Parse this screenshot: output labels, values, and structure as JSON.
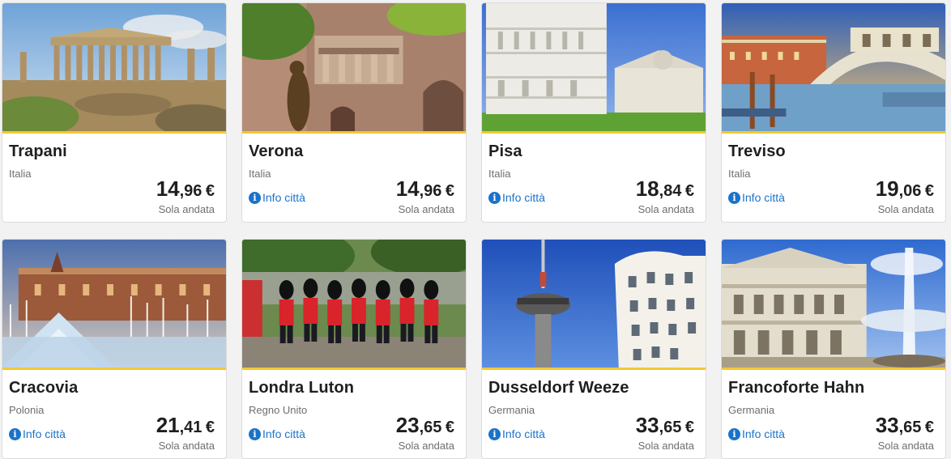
{
  "cards": [
    {
      "city": "Trapani",
      "country": "Italia",
      "info": "",
      "price_int": "14",
      "price_dec": "96",
      "currency": "€",
      "trip": "Sola andata",
      "image": "greek-temple-ruins-photo"
    },
    {
      "city": "Verona",
      "country": "Italia",
      "info": "Info città",
      "price_int": "14",
      "price_dec": "96",
      "currency": "€",
      "trip": "Sola andata",
      "image": "juliet-statue-balcony-photo"
    },
    {
      "city": "Pisa",
      "country": "Italia",
      "info": "Info città",
      "price_int": "18",
      "price_dec": "84",
      "currency": "€",
      "trip": "Sola andata",
      "image": "leaning-tower-cathedral-photo"
    },
    {
      "city": "Treviso",
      "country": "Italia",
      "info": "Info città",
      "price_int": "19",
      "price_dec": "06",
      "currency": "€",
      "trip": "Sola andata",
      "image": "canal-bridge-photo"
    },
    {
      "city": "Cracovia",
      "country": "Polonia",
      "info": "Info città",
      "price_int": "21",
      "price_dec": "41",
      "currency": "€",
      "trip": "Sola andata",
      "image": "cloth-hall-fountain-photo"
    },
    {
      "city": "Londra Luton",
      "country": "Regno Unito",
      "info": "Info città",
      "price_int": "23",
      "price_dec": "65",
      "currency": "€",
      "trip": "Sola andata",
      "image": "royal-guards-parade-photo"
    },
    {
      "city": "Dusseldorf Weeze",
      "country": "Germania",
      "info": "Info città",
      "price_int": "33",
      "price_dec": "65",
      "currency": "€",
      "trip": "Sola andata",
      "image": "rhine-tower-photo"
    },
    {
      "city": "Francoforte Hahn",
      "country": "Germania",
      "info": "Info città",
      "price_int": "33",
      "price_dec": "65",
      "currency": "€",
      "trip": "Sola andata",
      "image": "opera-house-fountain-photo"
    }
  ],
  "colors": {
    "accent_line": "#f1c933",
    "link": "#1a73c9",
    "text": "#1f1f1f",
    "muted": "#6e6e6e"
  }
}
